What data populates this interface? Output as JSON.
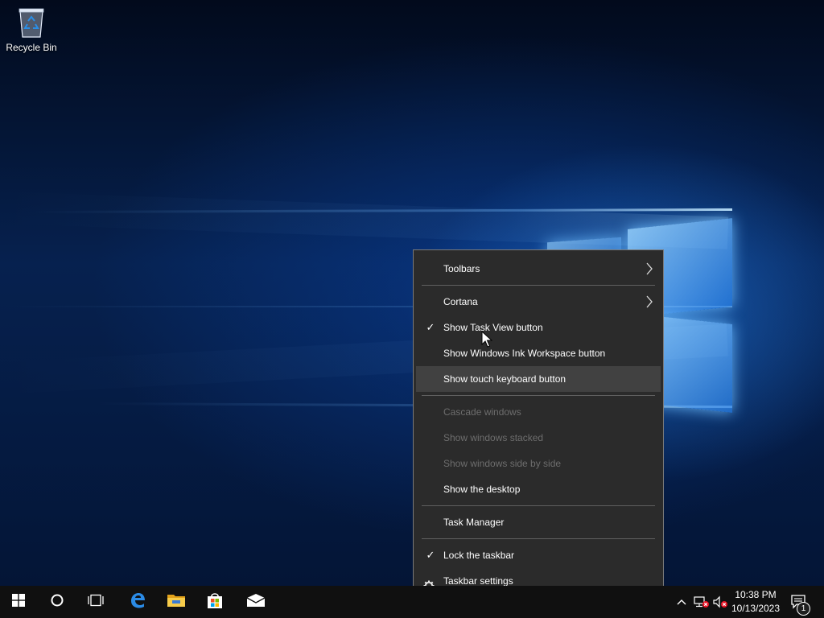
{
  "desktop": {
    "icons": [
      {
        "label": "Recycle Bin",
        "icon": "recycle-bin-icon"
      }
    ]
  },
  "context_menu": {
    "items": [
      {
        "label": "Toolbars",
        "submenu": true
      },
      {
        "separator": true
      },
      {
        "label": "Cortana",
        "submenu": true
      },
      {
        "label": "Show Task View button",
        "checked": true
      },
      {
        "label": "Show Windows Ink Workspace button"
      },
      {
        "label": "Show touch keyboard button",
        "hovered": true
      },
      {
        "separator": true
      },
      {
        "label": "Cascade windows",
        "disabled": true
      },
      {
        "label": "Show windows stacked",
        "disabled": true
      },
      {
        "label": "Show windows side by side",
        "disabled": true
      },
      {
        "label": "Show the desktop"
      },
      {
        "separator": true
      },
      {
        "label": "Task Manager"
      },
      {
        "separator": true
      },
      {
        "label": "Lock the taskbar",
        "checked": true
      },
      {
        "label": "Taskbar settings",
        "icon": "gear-icon"
      }
    ]
  },
  "taskbar": {
    "buttons": [
      {
        "name": "start-button",
        "icon": "windows-logo-icon"
      },
      {
        "name": "cortana-search-button",
        "icon": "circle-icon"
      },
      {
        "name": "task-view-button",
        "icon": "task-view-icon"
      },
      {
        "name": "edge-button",
        "icon": "edge-icon"
      },
      {
        "name": "file-explorer-button",
        "icon": "folder-icon"
      },
      {
        "name": "store-button",
        "icon": "store-icon"
      },
      {
        "name": "mail-button",
        "icon": "mail-icon"
      }
    ],
    "tray": {
      "icons": [
        "chevron-up-icon",
        "network-error-icon",
        "volume-muted-icon"
      ],
      "time": "10:38 PM",
      "date": "10/13/2023",
      "notification_count": "1"
    }
  },
  "colors": {
    "menu_bg": "#2b2b2b",
    "menu_hover": "#414141",
    "menu_disabled_text": "#6d6d6d",
    "taskbar_bg": "#101010",
    "edge_blue": "#0f6fd6",
    "folder_yellow": "#f2c94c"
  }
}
